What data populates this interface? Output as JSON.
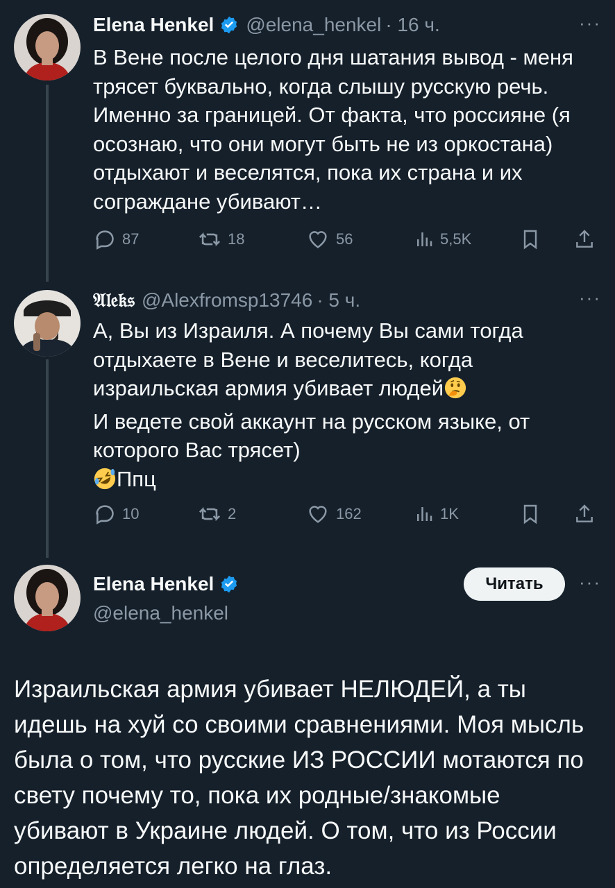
{
  "tweets": [
    {
      "name": "Elena Henkel",
      "handle": "@elena_henkel",
      "time": "· 16 ч.",
      "text": "В Вене после целого дня шатания вывод - меня трясет буквально, когда слышу русскую речь. Именно за границей. От факта, что россияне (я осознаю, что они могут быть не из оркостана) отдыхают и веселятся, пока их страна и их сограждане убивают…",
      "replies": "87",
      "reposts": "18",
      "likes": "56",
      "views": "5,5K"
    },
    {
      "name": "𝔄𝔩𝔢𝔨𝔰",
      "handle": "@Alexfromsp13746",
      "time": "· 5 ч.",
      "text_line1": "А, Вы из Израиля. А почему Вы сами тогда отдыхаете в Вене и веселитесь, когда израильская армия убивает людей",
      "emoji1": "thinking-face-emoji",
      "text_line2": "И ведете свой аккаунт на русском языке, от которого Вас трясет)",
      "emoji2": "rolling-on-floor-laughing-emoji",
      "text_line3": "Ппц",
      "replies": "10",
      "reposts": "2",
      "likes": "162",
      "views": "1K"
    }
  ],
  "main_tweet": {
    "name": "Elena Henkel",
    "handle": "@elena_henkel",
    "follow_label": "Читать",
    "text": "Израильская армия убивает НЕЛЮДЕЙ, а ты идешь на хуй со своими сравнениями. Моя мысль была о том, что русские ИЗ РОССИИ мотаются по свету почему то, пока их родные/знакомые убивают в Украине людей. О том, что из России определяется легко на глаз."
  },
  "more_label": "···",
  "colors": {
    "background": "#15202b",
    "text": "#f7f9f9",
    "secondary": "#8b98a5",
    "verified": "#1d9bf0"
  }
}
